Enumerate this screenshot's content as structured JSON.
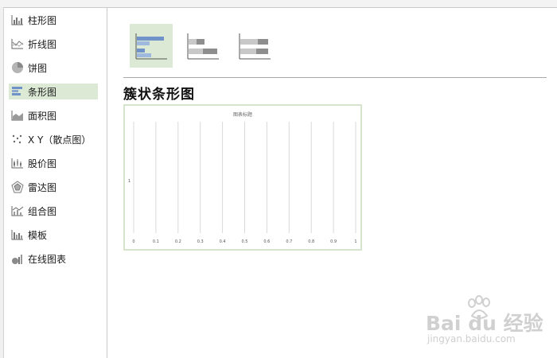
{
  "sidebar": {
    "items": [
      {
        "label": "柱形图",
        "icon": "column-chart-icon"
      },
      {
        "label": "折线图",
        "icon": "line-chart-icon"
      },
      {
        "label": "饼图",
        "icon": "pie-chart-icon"
      },
      {
        "label": "条形图",
        "icon": "bar-chart-icon",
        "selected": true
      },
      {
        "label": "面积图",
        "icon": "area-chart-icon"
      },
      {
        "label": "X Y（散点图）",
        "icon": "scatter-chart-icon"
      },
      {
        "label": "股价图",
        "icon": "stock-chart-icon"
      },
      {
        "label": "雷达图",
        "icon": "radar-chart-icon"
      },
      {
        "label": "组合图",
        "icon": "combo-chart-icon"
      },
      {
        "label": "模板",
        "icon": "template-icon"
      },
      {
        "label": "在线图表",
        "icon": "online-chart-icon"
      }
    ]
  },
  "subtypes": [
    {
      "icon": "clustered-bar-icon",
      "selected": true
    },
    {
      "icon": "stacked-bar-icon",
      "selected": false
    },
    {
      "icon": "percent-stacked-bar-icon",
      "selected": false
    }
  ],
  "main": {
    "subtype_heading": "簇状条形图"
  },
  "preview": {
    "chart_title": "图表标题",
    "y_label": "1",
    "x_ticks": [
      "0",
      "0.1",
      "0.2",
      "0.3",
      "0.4",
      "0.5",
      "0.6",
      "0.7",
      "0.8",
      "0.9",
      "1"
    ]
  },
  "colors": {
    "selected_bg": "#dce9d5",
    "bar_blue": "#6f93c8",
    "bar_gray": "#a9a9a9",
    "preview_border": "#d6e4cc"
  },
  "watermark": {
    "brand": "Bai du 经验",
    "url": "jingyan.baidu.com"
  },
  "chart_data": {
    "type": "bar",
    "title": "图表标题",
    "categories": [
      "1"
    ],
    "series": [],
    "xlim": [
      0,
      1
    ],
    "xticks": [
      0,
      0.1,
      0.2,
      0.3,
      0.4,
      0.5,
      0.6,
      0.7,
      0.8,
      0.9,
      1
    ],
    "grid": true
  }
}
